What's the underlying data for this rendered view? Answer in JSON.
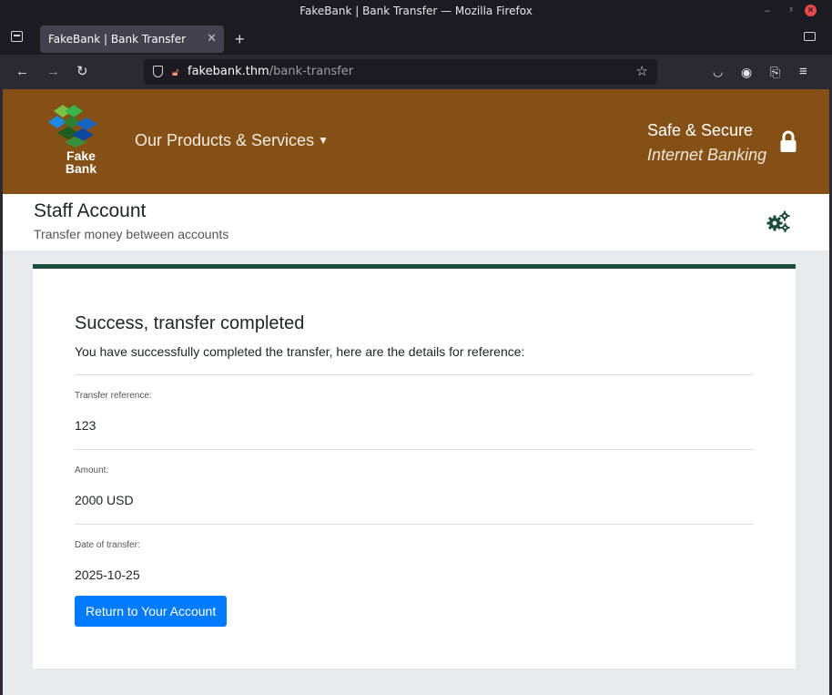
{
  "window": {
    "title": "FakeBank | Bank Transfer — Mozilla Firefox"
  },
  "browser": {
    "tab_title": "FakeBank | Bank Transfer",
    "url_host": "fakebank.thm",
    "url_path": "/bank-transfer"
  },
  "header": {
    "logo_line1": "Fake",
    "logo_line2": "Bank",
    "menu_label": "Our Products & Services",
    "secure_line1": "Safe & Secure",
    "secure_line2": "Internet Banking"
  },
  "subheader": {
    "title": "Staff Account",
    "description": "Transfer money between accounts"
  },
  "result": {
    "heading": "Success, transfer completed",
    "message": "You have successfully completed the transfer, here are the details for reference:",
    "fields": [
      {
        "label": "Transfer reference:",
        "value": "123"
      },
      {
        "label": "Amount:",
        "value": "2000 USD"
      },
      {
        "label": "Date of transfer:",
        "value": "2025-10-25"
      }
    ],
    "button_label": "Return to Your Account"
  },
  "colors": {
    "header_bg": "#845015",
    "card_accent": "#1d4e3b",
    "button": "#007bff"
  }
}
